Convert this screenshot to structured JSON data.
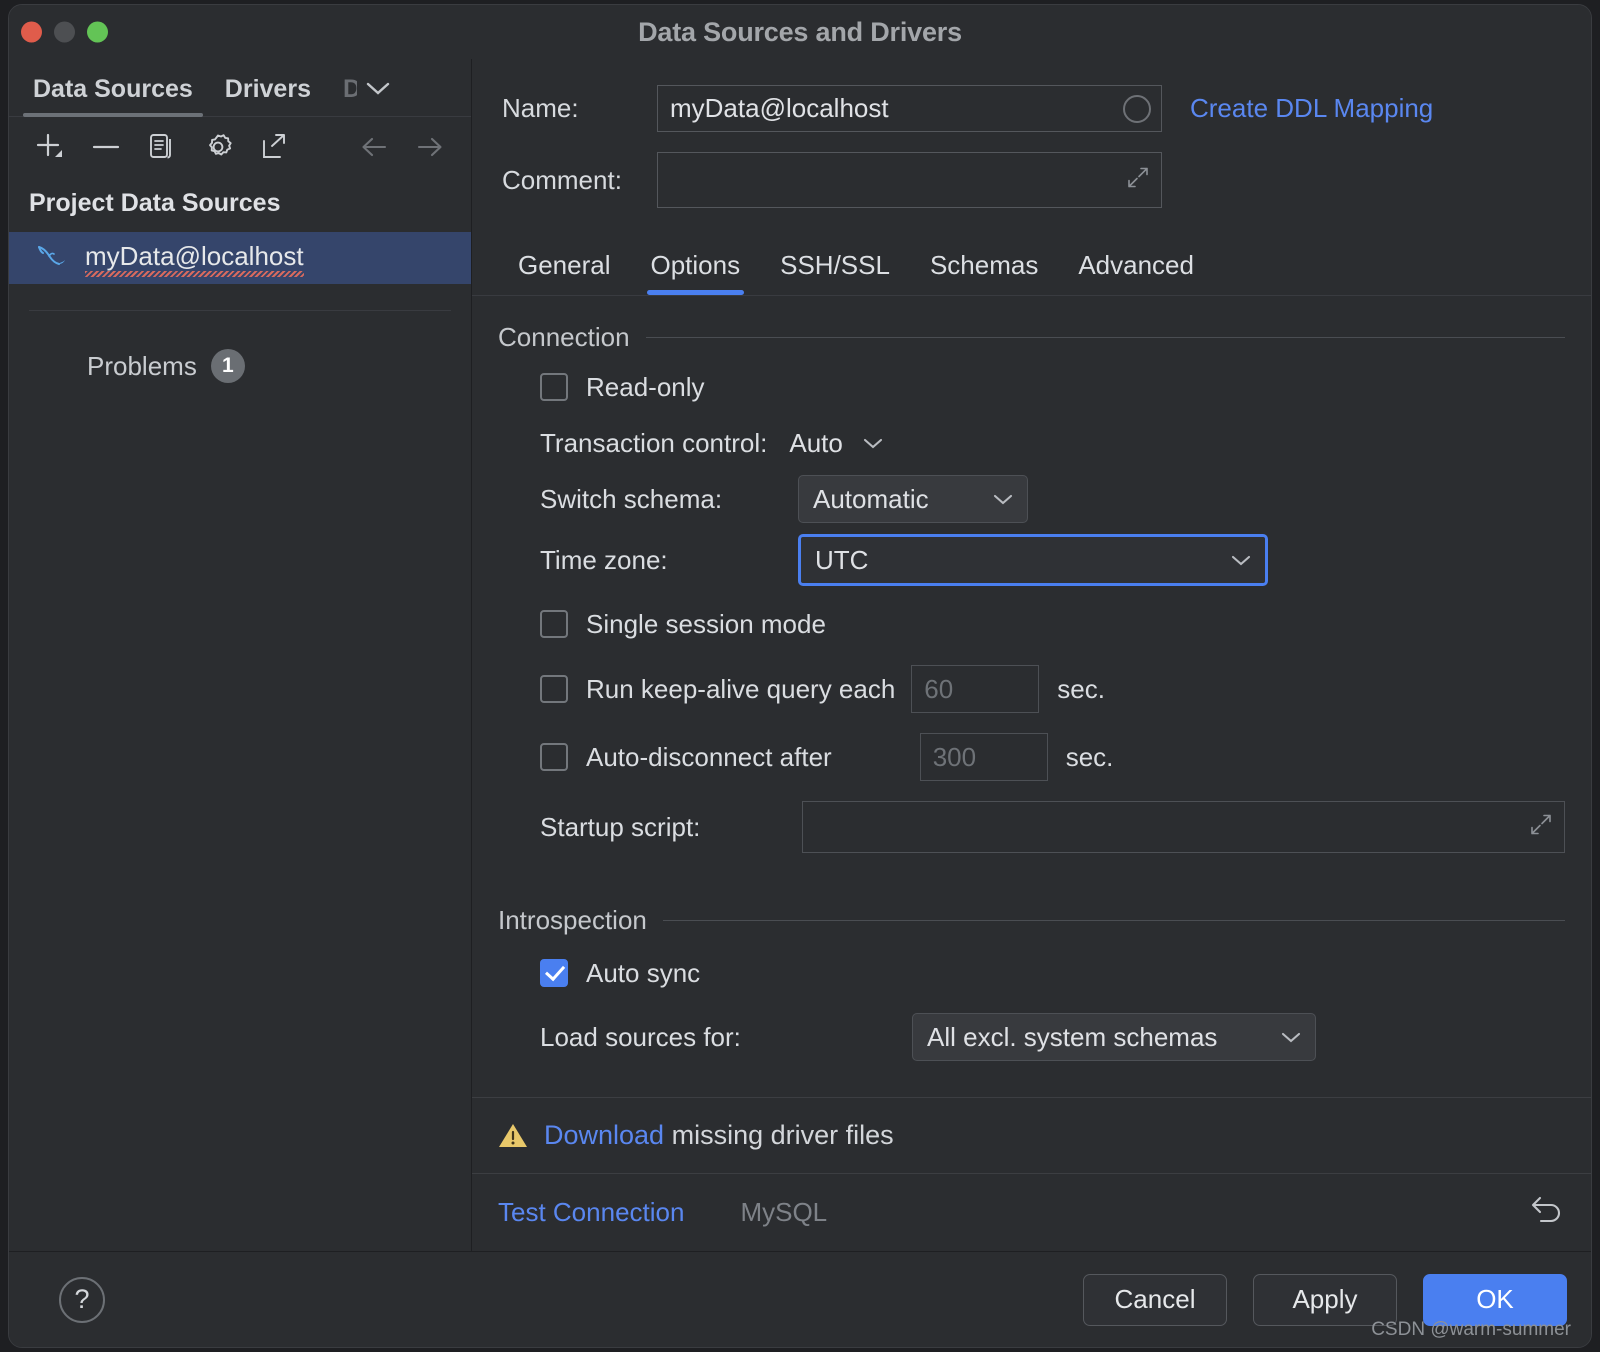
{
  "window": {
    "title": "Data Sources and Drivers",
    "traffic_lights": [
      "close-button",
      "minimize-button",
      "zoom-button"
    ]
  },
  "sidebar": {
    "tabs": [
      {
        "label": "Data Sources",
        "active": true
      },
      {
        "label": "Drivers",
        "active": false
      },
      {
        "label": "D",
        "active": false,
        "truncated": true
      }
    ],
    "toolbar_icons": [
      "add-icon",
      "remove-icon",
      "duplicate-icon",
      "settings-icon",
      "share-icon",
      "back-arrow-icon",
      "forward-arrow-icon"
    ],
    "section_title": "Project Data Sources",
    "data_source": {
      "name": "myData@localhost",
      "icon": "mysql-dolphin-icon",
      "selected": true,
      "has_error_underline": true
    },
    "problems": {
      "label": "Problems",
      "count": "1"
    }
  },
  "form": {
    "name_label": "Name:",
    "name_value": "myData@localhost",
    "comment_label": "Comment:",
    "comment_value": "",
    "create_ddl_link": "Create DDL Mapping"
  },
  "tabs": [
    {
      "label": "General",
      "active": false
    },
    {
      "label": "Options",
      "active": true
    },
    {
      "label": "SSH/SSL",
      "active": false
    },
    {
      "label": "Schemas",
      "active": false
    },
    {
      "label": "Advanced",
      "active": false
    }
  ],
  "connection": {
    "group_title": "Connection",
    "read_only": {
      "label": "Read-only",
      "checked": false
    },
    "transaction_control": {
      "label": "Transaction control:",
      "value": "Auto"
    },
    "switch_schema": {
      "label": "Switch schema:",
      "value": "Automatic"
    },
    "time_zone": {
      "label": "Time zone:",
      "value": "UTC",
      "focused": true
    },
    "single_session": {
      "label": "Single session mode",
      "checked": false
    },
    "keep_alive": {
      "label": "Run keep-alive query each",
      "placeholder": "60",
      "unit": "sec.",
      "checked": false
    },
    "auto_disconnect": {
      "label": "Auto-disconnect after",
      "placeholder": "300",
      "unit": "sec.",
      "checked": false
    },
    "startup_script": {
      "label": "Startup script:",
      "value": ""
    }
  },
  "introspection": {
    "group_title": "Introspection",
    "auto_sync": {
      "label": "Auto sync",
      "checked": true
    },
    "load_sources": {
      "label": "Load sources for:",
      "value": "All excl. system schemas"
    }
  },
  "warning": {
    "icon": "warning-triangle-icon",
    "link_text": "Download",
    "rest_text": " missing driver files"
  },
  "test_bar": {
    "test_link": "Test Connection",
    "driver": "MySQL",
    "revert_icon": "revert-icon"
  },
  "footer": {
    "help": "?",
    "cancel": "Cancel",
    "apply": "Apply",
    "ok": "OK"
  },
  "watermark": "CSDN @warm-summer",
  "colors": {
    "accent_blue": "#4a7ff0",
    "link_blue": "#5a87f0",
    "selection_blue": "#35456b",
    "window_bg": "#2b2d30",
    "warning_yellow": "#e8c86a",
    "error_red": "#e06c5e"
  }
}
